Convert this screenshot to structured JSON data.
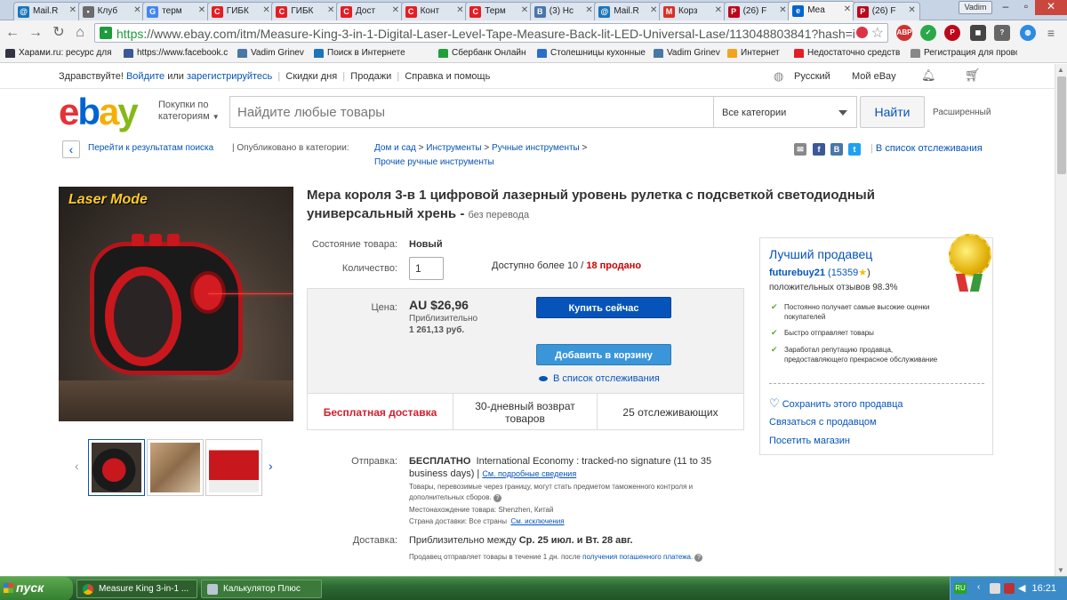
{
  "browser": {
    "tabs": [
      {
        "label": "Mail.R",
        "icon": "mailru-icon",
        "color": "#1b75bb"
      },
      {
        "label": "Клуб",
        "icon": "folder-icon",
        "color": "#6b6b6b"
      },
      {
        "label": "терм",
        "icon": "google-icon",
        "color": "#4285f4"
      },
      {
        "label": "ГИБК",
        "icon": "c-logo-icon",
        "color": "#e31e24"
      },
      {
        "label": "ГИБК",
        "icon": "c-logo-icon",
        "color": "#e31e24"
      },
      {
        "label": "Дост",
        "icon": "c-logo-icon",
        "color": "#e31e24"
      },
      {
        "label": "Конт",
        "icon": "c-logo-icon",
        "color": "#e31e24"
      },
      {
        "label": "Терм",
        "icon": "c-logo-icon",
        "color": "#e31e24"
      },
      {
        "label": "(3) Нс",
        "icon": "vk-icon",
        "color": "#4a76a8"
      },
      {
        "label": "Mail.R",
        "icon": "mailru-icon",
        "color": "#1b75bb"
      },
      {
        "label": "Корз",
        "icon": "gmail-icon",
        "color": "#d93025"
      },
      {
        "label": "(26) F",
        "icon": "pinterest-icon",
        "color": "#bd081c"
      },
      {
        "label": "Меа",
        "icon": "ebay-icon",
        "color": "#0064d2"
      },
      {
        "label": "(26) F",
        "icon": "pinterest-icon",
        "color": "#bd081c"
      }
    ],
    "user_badge": "Vadim",
    "url_scheme": "https",
    "url_rest": "://www.ebay.com/itm/Measure-King-3-in-1-Digital-Laser-Level-Tape-Measure-Back-lit-LED-Universal-Lase/113048803841?hash=i",
    "bookmarks": [
      {
        "label": "Харами.ru: ресурс для",
        "color": "#334"
      },
      {
        "label": "https://www.facebook.c",
        "color": "#3b5998"
      },
      {
        "label": "Vadim Grinev",
        "color": "#4a76a8"
      },
      {
        "label": "Поиск в Интернете",
        "color": "#1b75bb"
      },
      {
        "label": "",
        "color": "#4285f4"
      },
      {
        "label": "Сбербанк Онлайн",
        "color": "#21a038"
      },
      {
        "label": "Столешницы кухонные",
        "color": "#2a6fc9"
      },
      {
        "label": "Vadim Grinev",
        "color": "#4a76a8"
      },
      {
        "label": "Интернет",
        "color": "#f1a41f"
      },
      {
        "label": "Недостаточно средств",
        "color": "#e31e24"
      },
      {
        "label": "Регистрация для прово",
        "color": "#888"
      }
    ]
  },
  "topbar": {
    "greeting": "Здравствуйте!",
    "signin": "Войдите",
    "or": "или",
    "register": "зарегистрируйтесь",
    "deals": "Скидки дня",
    "sell": "Продажи",
    "help": "Справка и помощь",
    "language": "Русский",
    "my_ebay": "Мой eBay"
  },
  "search": {
    "shop_by": [
      "Покупки по",
      "категориям"
    ],
    "placeholder": "Найдите любые товары",
    "category": "Все категории",
    "button": "Найти",
    "advanced": "Расширенный"
  },
  "breadcrumbs": {
    "back": "Перейти к результатам поиска",
    "published_in": "| Опубликовано в категории:",
    "path1": "Дом и сад",
    "path2": "Инструменты",
    "path3": "Ручные инструменты",
    "path4": "Прочие ручные инструменты",
    "watchlist": "В список отслеживания"
  },
  "product": {
    "title": "Мера короля 3-в 1 цифровой лазерный уровень рулетка с подсветкой светодиодный универсальный хрень -",
    "no_translation": "без перевода",
    "image_caption": "Laser Mode",
    "condition_label": "Состояние товара:",
    "condition": "Новый",
    "quantity_label": "Количество:",
    "quantity": "1",
    "available": "Доступно более 10 /",
    "sold": "18 продано",
    "price_label": "Цена:",
    "price": "AU $26,96",
    "approx_label": "Приблизительно",
    "approx_price": "1 261,13 руб.",
    "buy_now": "Купить сейчас",
    "add_to_cart": "Добавить в корзину",
    "watch": "В список отслеживания",
    "features": [
      "Бесплатная доставка",
      "30-дневный возврат товаров",
      "25 отслеживающих"
    ]
  },
  "shipping": {
    "label": "Отправка:",
    "free": "БЕСПЛАТНО",
    "method": "International Economy : tracked-no signature (11 to 35 business days) |",
    "details_link": "См. подробные сведения",
    "customs": "Товары, перевозимые через границу, могут стать предметом таможенного контроля и дополнительных сборов.",
    "location": "Местонахождение товара:  Shenzhen, Китай",
    "ships_to": "Страна доставки: Все страны",
    "exclusions": "См. исключения",
    "delivery_label": "Доставка:",
    "delivery": "Приблизительно между",
    "delivery_dates": "Ср. 25 июл. и Вт. 28 авг.",
    "handling": "Продавец отправляет товары в течение 1 дн. после",
    "handling_link": "получения погашенного платежа",
    "handling_end": "."
  },
  "seller": {
    "heading": "Лучший продавец",
    "name": "futurebuy21",
    "feedback": "(15359",
    "feedback_end": ")",
    "positive": "положительных отзывов 98.3%",
    "checks": [
      "Постоянно получает самые высокие оценки покупателей",
      "Быстро отправляет товары",
      "Заработал репутацию продавца, предоставляющего прекрасное обслуживание"
    ],
    "save": "Сохранить этого продавца",
    "contact": "Связаться с продавцом",
    "store": "Посетить магазин"
  },
  "taskbar": {
    "start": "пуск",
    "tasks": [
      "Measure King 3-in-1 ...",
      "Калькулятор Плюс"
    ],
    "lang": "RU",
    "clock": "16:21"
  }
}
